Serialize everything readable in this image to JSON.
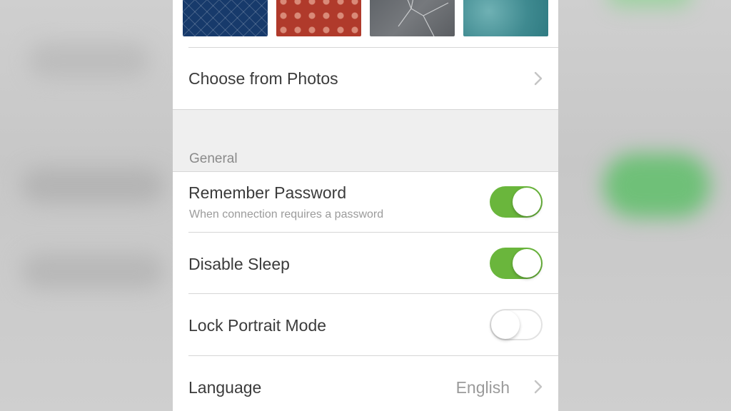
{
  "colors": {
    "toggle_on": "#6ab63c",
    "panel_bg": "#ffffff",
    "section_bg": "#efefef"
  },
  "wallpapers": [
    {
      "name": "blue-pattern"
    },
    {
      "name": "red-polka-dots"
    },
    {
      "name": "cracked-grey"
    },
    {
      "name": "water-texture"
    }
  ],
  "photos": {
    "label": "Choose from Photos",
    "icon": "chevron-right-icon"
  },
  "general": {
    "header": "General",
    "remember_password": {
      "label": "Remember Password",
      "subtitle": "When connection requires a password",
      "enabled": true
    },
    "disable_sleep": {
      "label": "Disable Sleep",
      "enabled": true
    },
    "lock_portrait": {
      "label": "Lock Portrait Mode",
      "enabled": false
    },
    "language": {
      "label": "Language",
      "value": "English",
      "icon": "chevron-right-icon"
    }
  }
}
